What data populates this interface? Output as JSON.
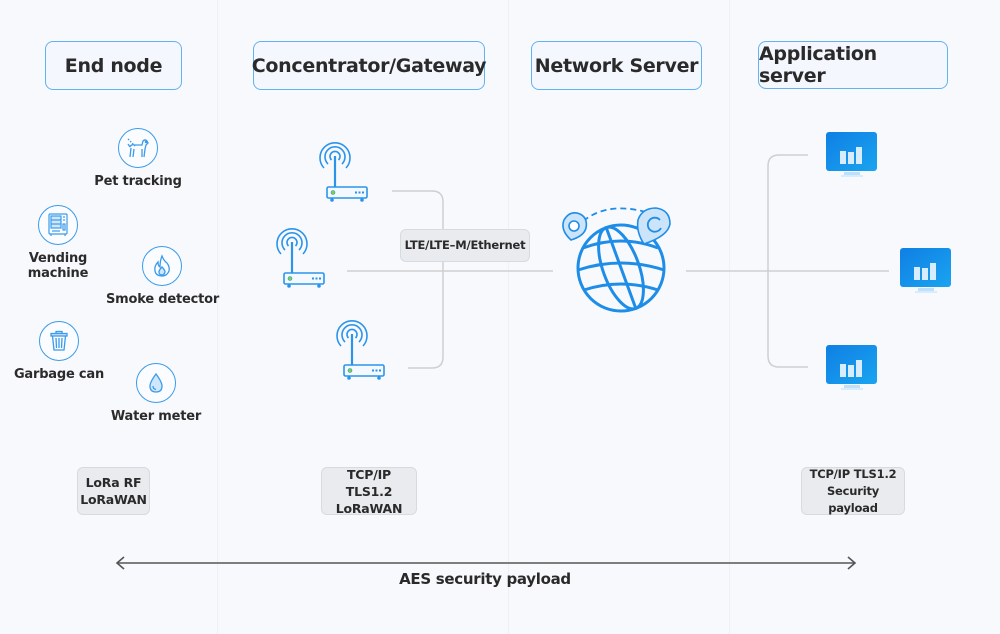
{
  "columns": [
    {
      "title": "End node"
    },
    {
      "title": "Concentrator/Gateway"
    },
    {
      "title": "Network Server"
    },
    {
      "title": "Application server"
    }
  ],
  "end_nodes": [
    {
      "label": "Pet tracking",
      "icon": "dog-icon"
    },
    {
      "label": "Vending\nmachine",
      "label_line1": "Vending",
      "label_line2": "machine",
      "icon": "vending-machine-icon"
    },
    {
      "label": "Smoke detector",
      "icon": "flame-icon"
    },
    {
      "label": "Garbage can",
      "icon": "trash-can-icon"
    },
    {
      "label": "Water meter",
      "icon": "water-drop-icon"
    }
  ],
  "gateways": [
    {
      "icon": "gateway-router-icon"
    },
    {
      "icon": "gateway-router-icon"
    },
    {
      "icon": "gateway-router-icon"
    }
  ],
  "backhaul_label": "LTE/LTE–M/Ethernet",
  "network_server_icon": "globe-location-icon",
  "app_servers": [
    {
      "icon": "monitor-chart-icon"
    },
    {
      "icon": "monitor-chart-icon"
    },
    {
      "icon": "monitor-chart-icon"
    }
  ],
  "protocols": {
    "end_node": {
      "line1": "LoRa RF",
      "line2": "LoRaWAN"
    },
    "gateway": {
      "line1": "TCP/IP TLS1.2",
      "line2": "LoRaWAN"
    },
    "app_server": {
      "line1": "TCP/IP TLS1.2",
      "line2": "Security payload"
    }
  },
  "footer": {
    "label": "AES security payload"
  },
  "colors": {
    "accent": "#1a8ceb",
    "heading_border": "#62b2f0",
    "connector": "#cfcfd2",
    "tag_bg": "#e9ebef",
    "background": "#f8f9fd"
  }
}
